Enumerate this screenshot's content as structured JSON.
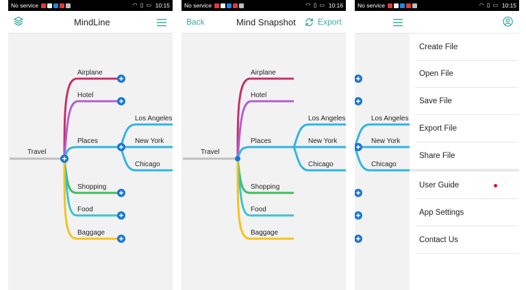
{
  "status_bars": [
    {
      "carrier": "No service",
      "time": "10:15"
    },
    {
      "carrier": "No service",
      "time": "10:16"
    },
    {
      "carrier": "No service",
      "time": "10:15"
    }
  ],
  "screen1": {
    "title": "MindLine"
  },
  "screen2": {
    "back_label": "Back",
    "title": "Mind Snapshot",
    "export_label": "Export"
  },
  "mindmap": {
    "root": "Travel",
    "branches": [
      "Airplane",
      "Hotel",
      "Places",
      "Shopping",
      "Food",
      "Baggage"
    ],
    "places": [
      "Los Angeles",
      "New York",
      "Chicago"
    ],
    "colors": {
      "airplane": "#c2306a",
      "hotel": "#b65ad6",
      "places": "#2fb4e3",
      "shopping": "#3cbf5a",
      "food": "#37c3df",
      "baggage": "#f0c419",
      "root": "#bdbdbd",
      "node": "#1976d2"
    }
  },
  "menu": {
    "items": [
      "Create File",
      "Open File",
      "Save File",
      "Export File",
      "Share File"
    ],
    "items2": [
      "User Guide",
      "App Settings",
      "Contact Us"
    ]
  }
}
